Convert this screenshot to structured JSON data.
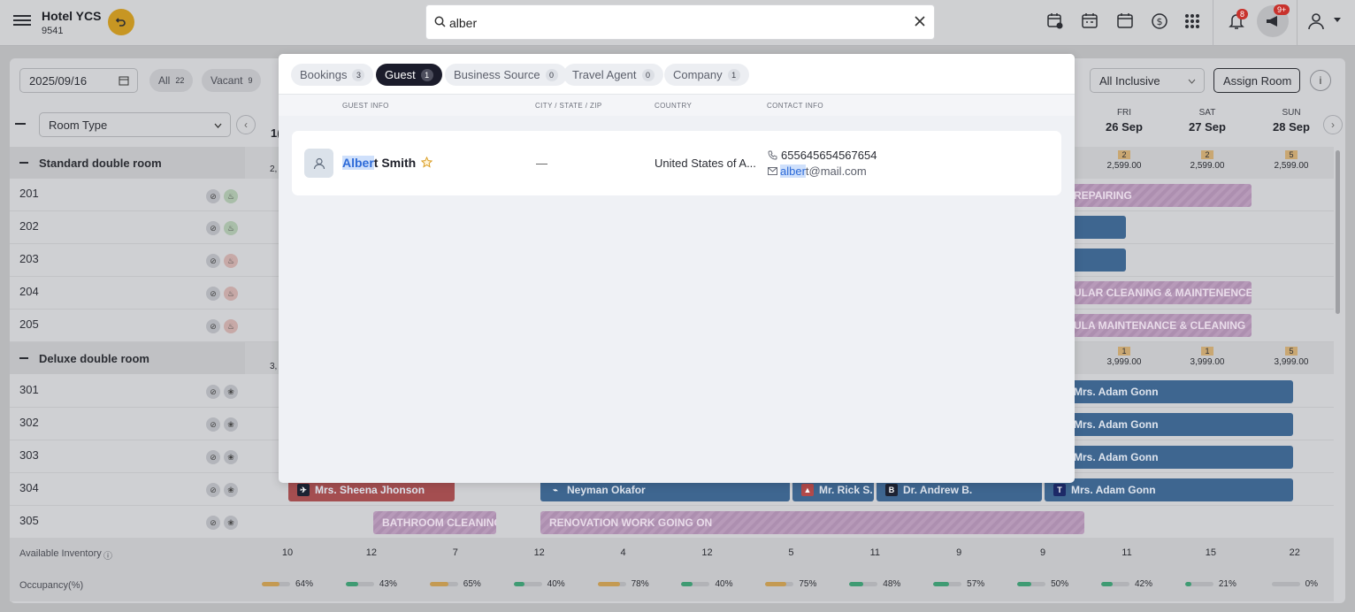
{
  "header": {
    "hotel_name": "Hotel YCS",
    "hotel_id": "9541",
    "search": {
      "value": "alber",
      "placeholder": "Search"
    },
    "notifications_badge": "8",
    "announcements_badge": "9+"
  },
  "toolbar": {
    "date": "2025/09/16",
    "filters": [
      {
        "label": "All",
        "count": "22"
      },
      {
        "label": "Vacant",
        "count": "9"
      }
    ],
    "room_type_select": "Room Type",
    "meal_plan_select": "All Inclusive",
    "assign_room_label": "Assign Room"
  },
  "calendar": {
    "first_day_fragment": "1(",
    "days": [
      {
        "dow": "FRI",
        "date": "26 Sep"
      },
      {
        "dow": "SAT",
        "date": "27 Sep"
      },
      {
        "dow": "SUN",
        "date": "28 Sep"
      }
    ],
    "groups": [
      {
        "name": "Standard double room",
        "left_fragment": "2,",
        "counts": [
          {
            "n": "2",
            "price": "2,599.00"
          },
          {
            "n": "2",
            "price": "2,599.00"
          },
          {
            "n": "5",
            "price": "2,599.00"
          }
        ],
        "rooms": [
          "201",
          "202",
          "203",
          "204",
          "205"
        ]
      },
      {
        "name": "Deluxe double room",
        "left_fragment": "3,",
        "counts": [
          {
            "n": "1",
            "price": "3,999.00"
          },
          {
            "n": "1",
            "price": "3,999.00"
          },
          {
            "n": "5",
            "price": "3,999.00"
          }
        ],
        "rooms": [
          "301",
          "302",
          "303",
          "304",
          "305"
        ]
      }
    ],
    "bars": {
      "b201": "REPAIRING",
      "b204": "ULAR CLEANING & MAINTENENCE",
      "b205": "ULA MAINTENANCE & CLEANING",
      "b301": "Mrs. Adam Gonn",
      "b302": "Mrs. Adam Gonn",
      "b303": "Mrs. Adam Gonn",
      "b304a": "Mrs. Sheena Jhonson",
      "b304b": "Neyman Okafor",
      "b304c": "Mr. Rick S.",
      "b304d": "Dr. Andrew B.",
      "b304e": "Mrs. Adam Gonn",
      "b305a": "BATHROOM CLEANING",
      "b305b": "RENOVATION WORK GOING ON"
    }
  },
  "footer": {
    "inventory_label": "Available Inventory",
    "occupancy_label": "Occupancy(%)",
    "inventory": [
      "10",
      "12",
      "7",
      "12",
      "4",
      "12",
      "5",
      "11",
      "9",
      "9",
      "11",
      "15",
      "22"
    ],
    "occupancy": [
      {
        "label": "64%",
        "value": 64,
        "color": "#c49a52"
      },
      {
        "label": "43%",
        "value": 43,
        "color": "#3f9b73"
      },
      {
        "label": "65%",
        "value": 65,
        "color": "#c49a52"
      },
      {
        "label": "40%",
        "value": 40,
        "color": "#3f9b73"
      },
      {
        "label": "78%",
        "value": 78,
        "color": "#c49a52"
      },
      {
        "label": "40%",
        "value": 40,
        "color": "#3f9b73"
      },
      {
        "label": "75%",
        "value": 75,
        "color": "#c49a52"
      },
      {
        "label": "48%",
        "value": 48,
        "color": "#3f9b73"
      },
      {
        "label": "57%",
        "value": 57,
        "color": "#3f9b73"
      },
      {
        "label": "50%",
        "value": 50,
        "color": "#3f9b73"
      },
      {
        "label": "42%",
        "value": 42,
        "color": "#3f9b73"
      },
      {
        "label": "21%",
        "value": 21,
        "color": "#3f9b73"
      },
      {
        "label": "0%",
        "value": 0,
        "color": "#3f9b73"
      }
    ]
  },
  "search_panel": {
    "tabs": [
      {
        "label": "Bookings",
        "count": "3"
      },
      {
        "label": "Guest",
        "count": "1"
      },
      {
        "label": "Business Source",
        "count": "0"
      },
      {
        "label": "Travel Agent",
        "count": "0"
      },
      {
        "label": "Company",
        "count": "1"
      }
    ],
    "columns": [
      "GUEST INFO",
      "CITY / STATE / ZIP",
      "COUNTRY",
      "CONTACT INFO"
    ],
    "result": {
      "name_match": "Alber",
      "name_rest": "t Smith",
      "city": "—",
      "country": "United States of A...",
      "phone": "655645654567654",
      "email_match": "alber",
      "email_rest": "t@mail.com"
    }
  }
}
